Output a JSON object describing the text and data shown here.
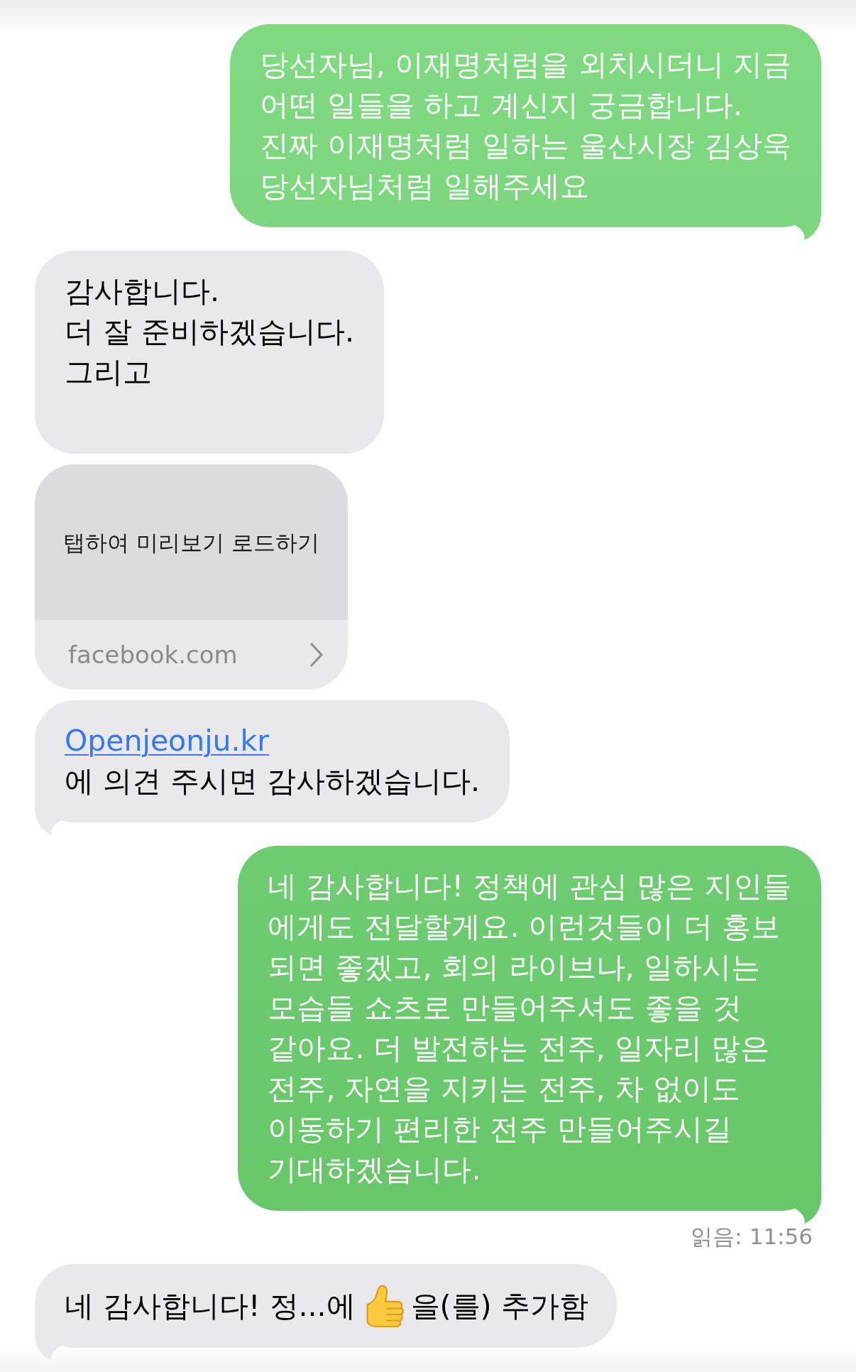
{
  "messages": [
    {
      "kind": "text",
      "outgoing": true,
      "tail": true,
      "text": "당선자님, 이재명처럼을 외치시더니 지금\n어떤 일들을 하고 계신지 궁금합니다.\n진짜 이재명처럼 일하는 울산시장 김상욱\n당선자님처럼 일해주세요"
    },
    {
      "kind": "text",
      "outgoing": false,
      "tail": false,
      "text": "감사합니다.\n더 잘 준비하겠습니다.\n그리고\n"
    },
    {
      "kind": "link_preview",
      "outgoing": false,
      "tail": false,
      "prompt": "탭하여 미리보기 로드하기",
      "domain": "facebook.com"
    },
    {
      "kind": "link_text",
      "outgoing": false,
      "tail": true,
      "link": "Openjeonju.kr",
      "text": "에 의견 주시면 감사하겠습니다."
    },
    {
      "kind": "text",
      "outgoing": true,
      "tail": true,
      "text": "네 감사합니다! 정책에 관심 많은 지인들\n에게도 전달할게요. 이런것들이 더 홍보\n되면 좋겠고, 회의 라이브나, 일하시는\n모습들 쇼츠로 만들어주셔도 좋을 것\n같아요. 더 발전하는 전주, 일자리 많은\n전주, 자연을 지키는 전주, 차 없이도\n이동하기 편리한 전주 만들어주시길\n기대하겠습니다."
    },
    {
      "kind": "read_receipt",
      "text": "읽음: 11:56"
    },
    {
      "kind": "reaction",
      "outgoing": false,
      "tail": true,
      "before": "네 감사합니다! 정...에",
      "after": "을(를) 추가함"
    }
  ]
}
